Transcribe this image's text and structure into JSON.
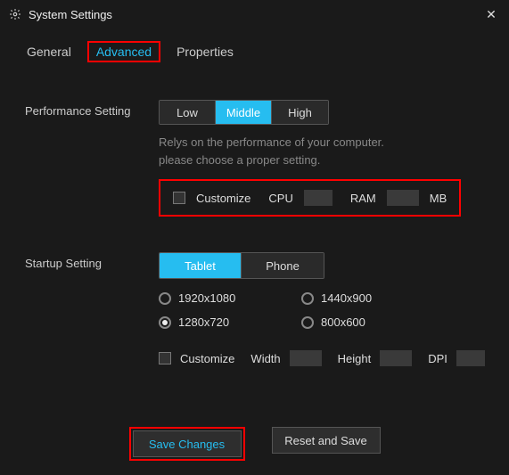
{
  "window": {
    "title": "System Settings"
  },
  "tabs": {
    "general": "General",
    "advanced": "Advanced",
    "properties": "Properties",
    "active": "advanced"
  },
  "perf": {
    "label": "Performance Setting",
    "low": "Low",
    "middle": "Middle",
    "high": "High",
    "active": "middle",
    "hint1": "Relys on the performance of your computer.",
    "hint2": "please choose a proper setting.",
    "customize": "Customize",
    "cpu": "CPU",
    "ram": "RAM",
    "mb": "MB"
  },
  "startup": {
    "label": "Startup Setting",
    "tablet": "Tablet",
    "phone": "Phone",
    "active": "tablet",
    "res": {
      "r1": "1920x1080",
      "r2": "1440x900",
      "r3": "1280x720",
      "r4": "800x600",
      "selected": "r3"
    },
    "customize": "Customize",
    "width": "Width",
    "height": "Height",
    "dpi": "DPI"
  },
  "buttons": {
    "save": "Save Changes",
    "reset": "Reset and Save"
  }
}
